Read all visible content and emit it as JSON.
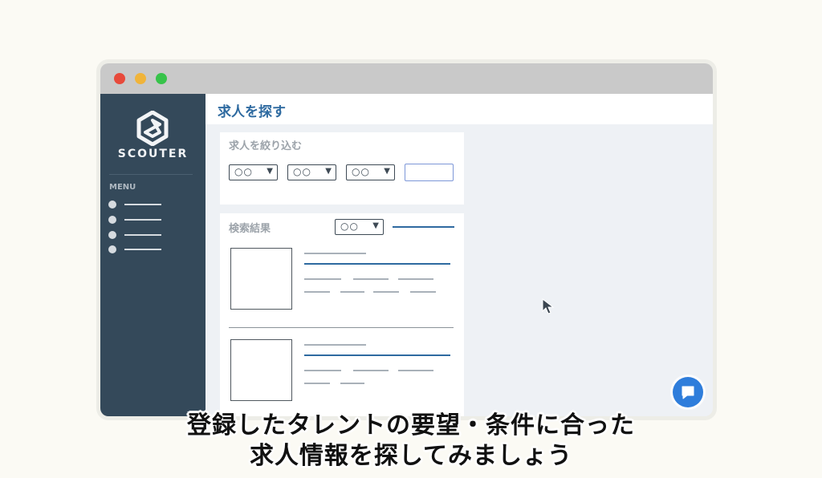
{
  "window": {
    "controls": [
      "close",
      "minimize",
      "maximize"
    ],
    "colors": {
      "close": "#e74a3b",
      "minimize": "#f0b43a",
      "maximize": "#37c34a"
    }
  },
  "sidebar": {
    "brand": "SCOUTER",
    "logo_icon": "scouter-logo-icon",
    "menu_label": "MENU",
    "items": [
      "",
      "",
      "",
      ""
    ],
    "background": "#34495a"
  },
  "header": {
    "title": "求人を探す"
  },
  "filter": {
    "title": "求人を絞り込む",
    "selects": [
      "○○",
      "○○",
      "○○"
    ],
    "text_input_value": ""
  },
  "results": {
    "title": "検索結果",
    "sort_select": "○○"
  },
  "chat_icon": "chat-bubble-icon",
  "cursor_icon": "mouse-pointer-icon",
  "subtitles": {
    "line1": "登録したタレントの要望・条件に合った",
    "line2": "求人情報を探してみましょう"
  },
  "accent_color": "#2e6aa0"
}
